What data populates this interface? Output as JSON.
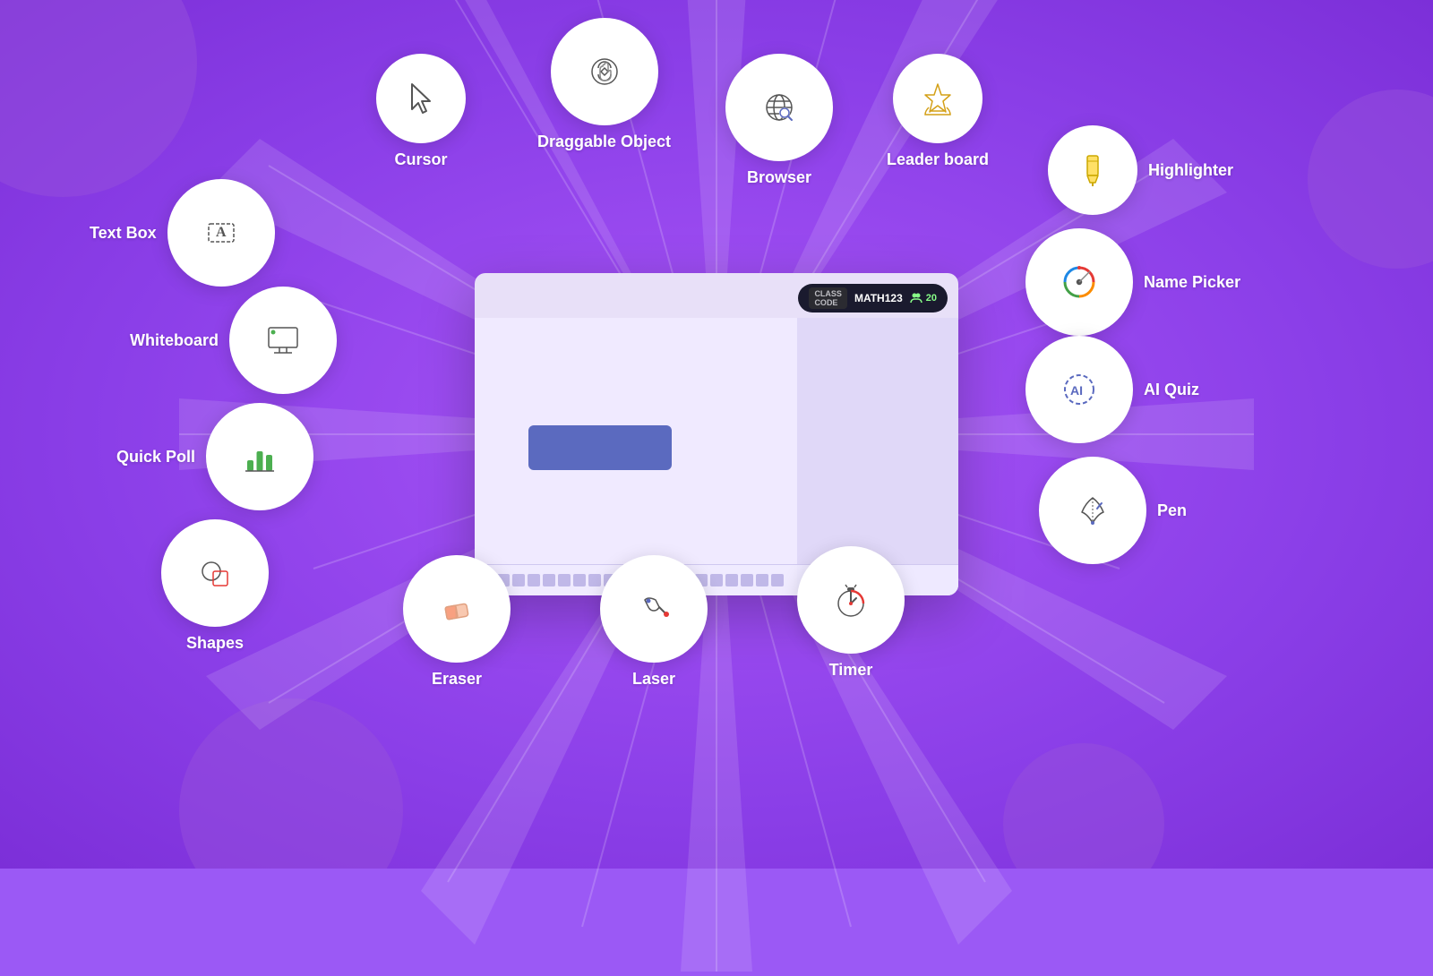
{
  "features": [
    {
      "id": "cursor",
      "label": "Cursor",
      "icon": "cursor"
    },
    {
      "id": "draggable",
      "label": "Draggable Object",
      "icon": "draggable"
    },
    {
      "id": "browser",
      "label": "Browser",
      "icon": "browser"
    },
    {
      "id": "leaderboard",
      "label": "Leader board",
      "icon": "leaderboard"
    },
    {
      "id": "textbox",
      "label": "Text Box",
      "icon": "textbox"
    },
    {
      "id": "highlighter",
      "label": "Highlighter",
      "icon": "highlighter"
    },
    {
      "id": "whiteboard",
      "label": "Whiteboard",
      "icon": "whiteboard"
    },
    {
      "id": "namepicker",
      "label": "Name Picker",
      "icon": "namepicker"
    },
    {
      "id": "quickpoll",
      "label": "Quick Poll",
      "icon": "quickpoll"
    },
    {
      "id": "aiquiz",
      "label": "AI Quiz",
      "icon": "aiquiz"
    },
    {
      "id": "shapes",
      "label": "Shapes",
      "icon": "shapes"
    },
    {
      "id": "pen",
      "label": "Pen",
      "icon": "pen"
    },
    {
      "id": "eraser",
      "label": "Eraser",
      "icon": "eraser"
    },
    {
      "id": "laser",
      "label": "Laser",
      "icon": "laser"
    },
    {
      "id": "timer",
      "label": "Timer",
      "icon": "timer"
    }
  ],
  "whiteboard": {
    "classCode": "CLASS CODE",
    "className": "MATH123",
    "participants": "20"
  }
}
